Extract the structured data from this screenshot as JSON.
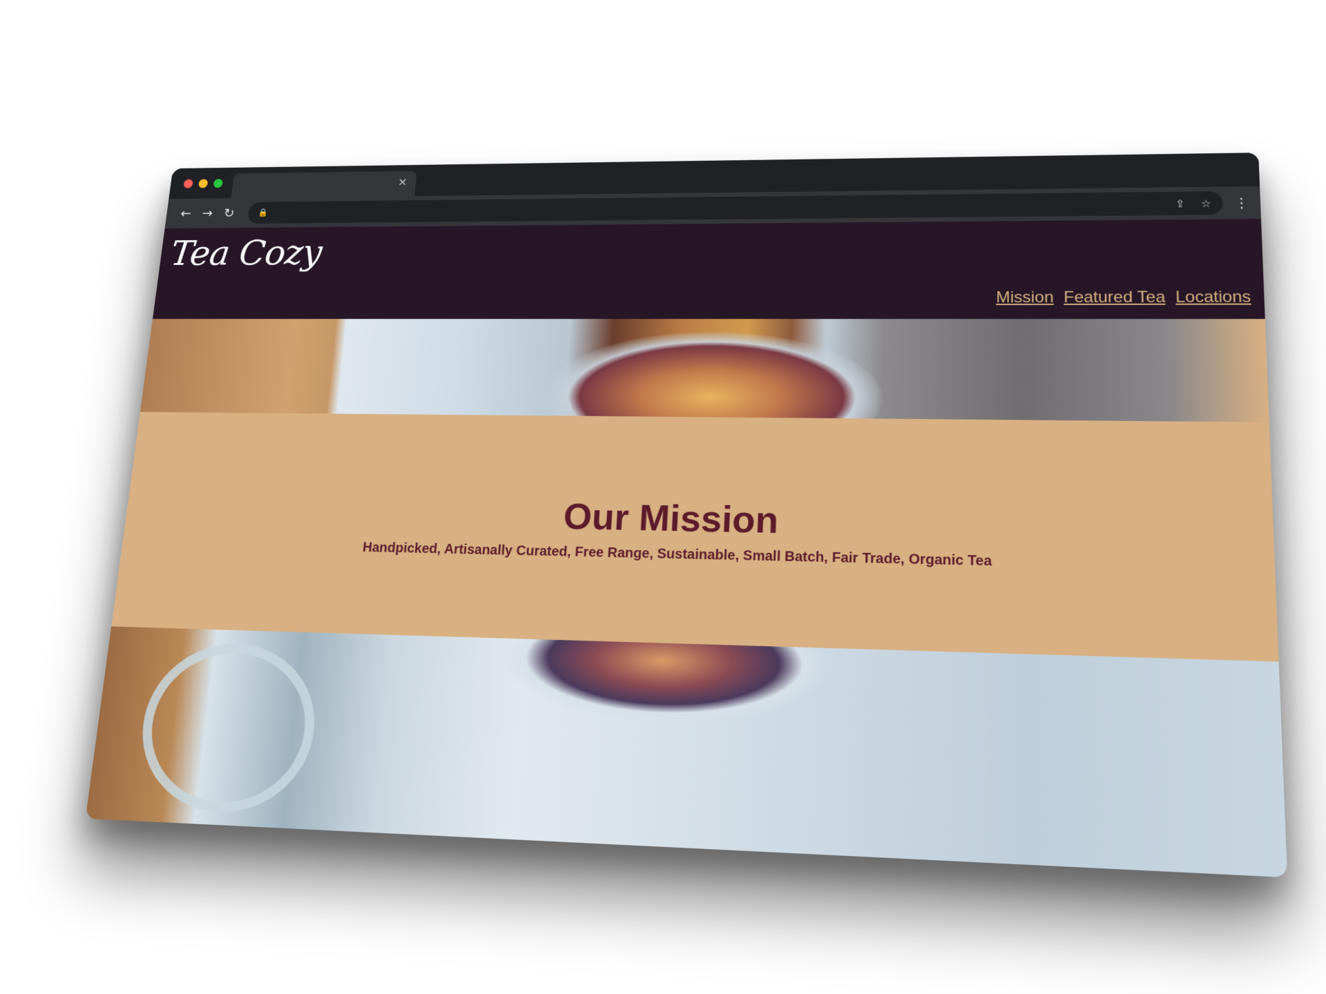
{
  "browser": {
    "tab_close_glyph": "×",
    "back_glyph": "←",
    "forward_glyph": "→",
    "reload_glyph": "↻",
    "lock_glyph": "🔒",
    "share_glyph": "⇪",
    "star_glyph": "☆",
    "menu_glyph": "⋮"
  },
  "site": {
    "logo": "Tea Cozy",
    "nav": [
      {
        "label": "Mission"
      },
      {
        "label": "Featured Tea"
      },
      {
        "label": "Locations"
      }
    ]
  },
  "mission": {
    "title": "Our Mission",
    "tagline": "Handpicked, Artisanally Curated, Free Range, Sustainable, Small Batch, Fair Trade, Organic Tea"
  },
  "colors": {
    "header_bg": "#261626",
    "accent": "#d8b082",
    "text_dark": "#5c1a2a"
  }
}
